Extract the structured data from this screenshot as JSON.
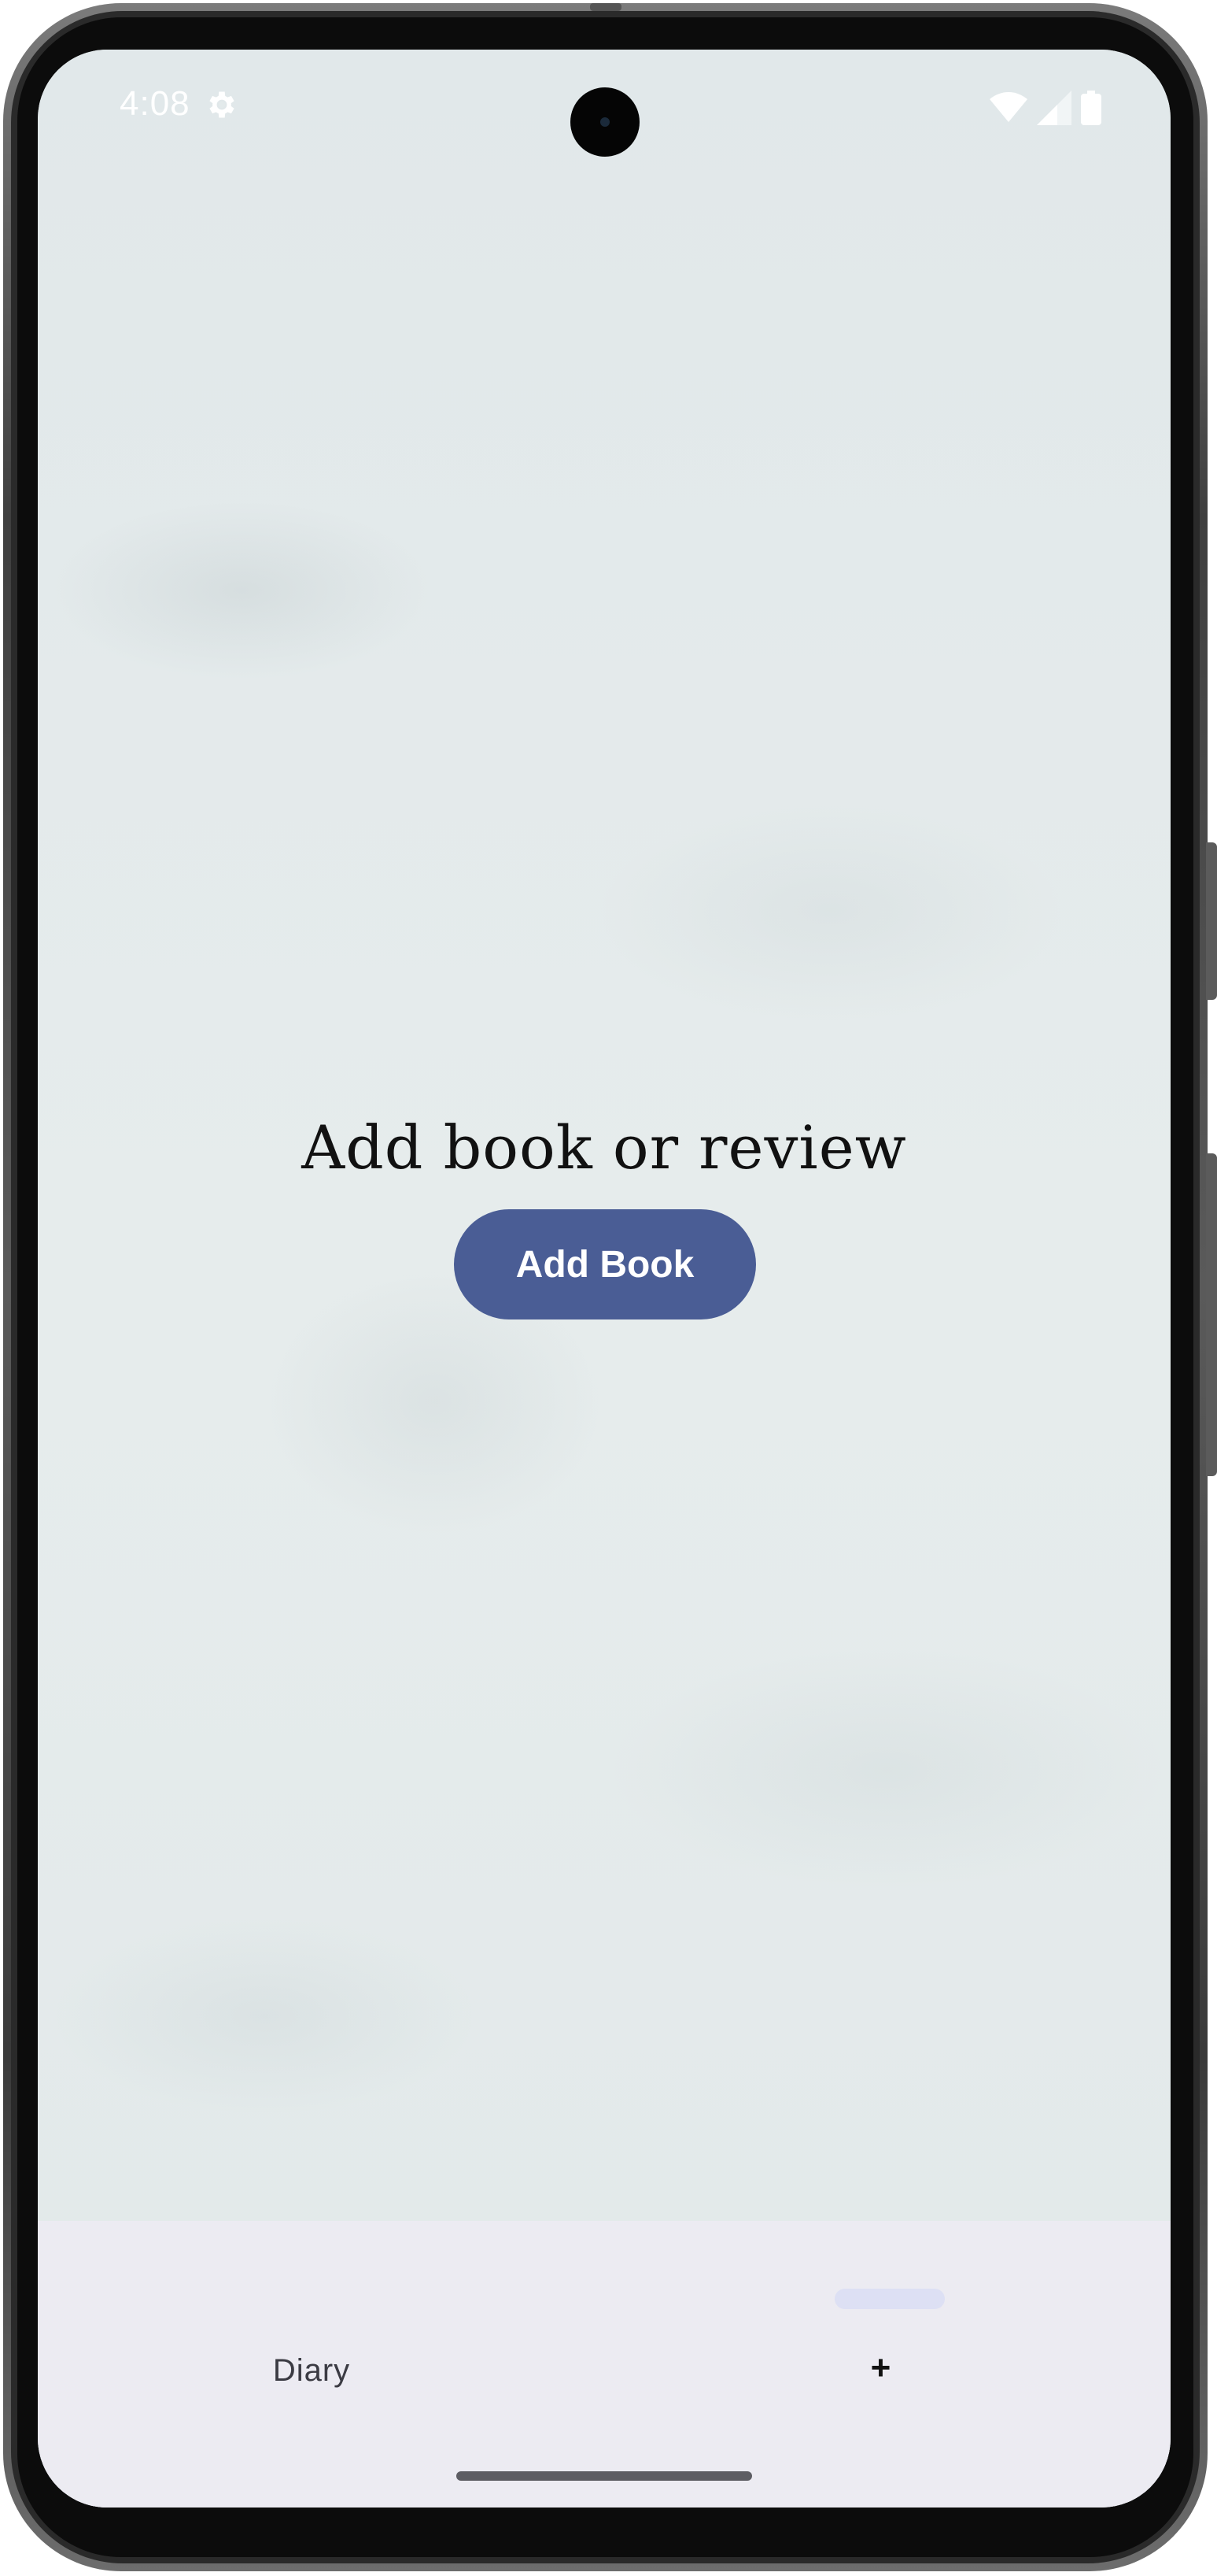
{
  "status_bar": {
    "time": "4:08",
    "icons": [
      "settings-gear-icon",
      "wifi-icon",
      "cell-signal-icon",
      "battery-icon"
    ]
  },
  "main": {
    "title": "Add book or review",
    "add_book_label": "Add Book"
  },
  "bottom_nav": {
    "items": [
      {
        "label": "Diary",
        "selected": false
      },
      {
        "label": "+",
        "selected": true
      }
    ]
  },
  "colors": {
    "background": "#e3eaeb",
    "primary_button": "#4a5d95",
    "nav_background": "#ecebf2",
    "nav_indicator": "#dde0f4"
  }
}
